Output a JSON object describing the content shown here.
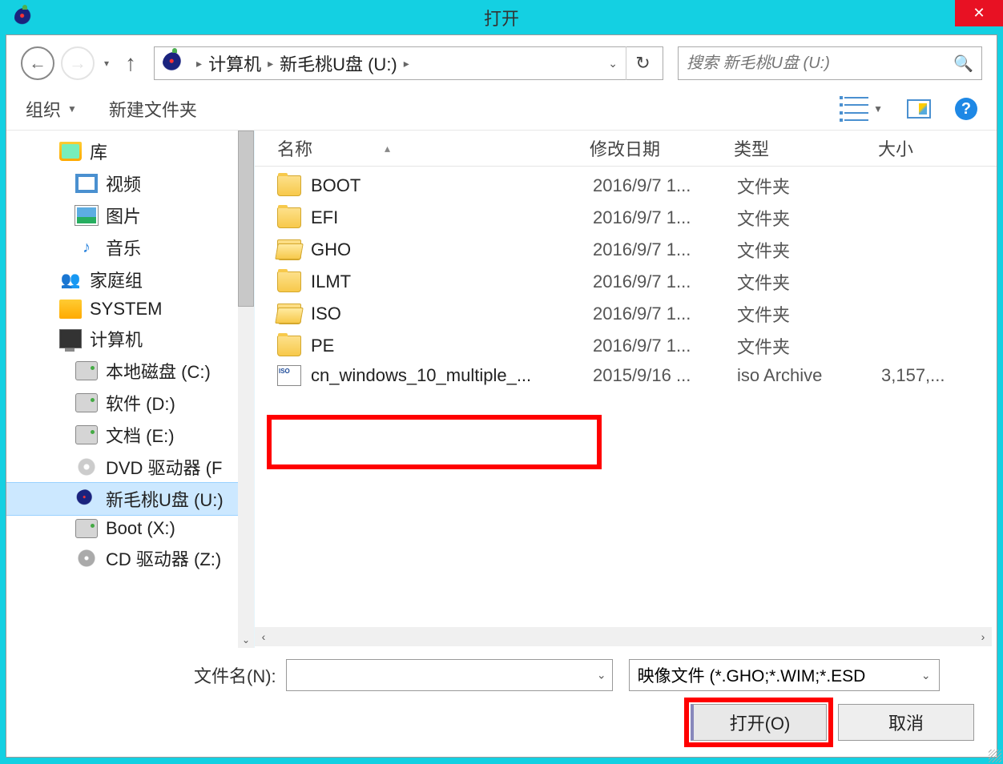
{
  "window": {
    "title": "打开",
    "close": "✕"
  },
  "nav": {
    "breadcrumb": {
      "computer": "计算机",
      "drive": "新毛桃U盘 (U:)"
    },
    "search_placeholder": "搜索 新毛桃U盘 (U:)"
  },
  "toolbar": {
    "organize": "组织",
    "new_folder": "新建文件夹"
  },
  "tree": {
    "libraries": "库",
    "videos": "视频",
    "pictures": "图片",
    "music": "音乐",
    "homegroup": "家庭组",
    "system": "SYSTEM",
    "computer": "计算机",
    "local_c": "本地磁盘 (C:)",
    "soft_d": "软件 (D:)",
    "doc_e": "文档 (E:)",
    "dvd_f": "DVD 驱动器 (F",
    "peach_u": "新毛桃U盘 (U:)",
    "boot_x": "Boot (X:)",
    "cd_z": "CD 驱动器 (Z:)"
  },
  "columns": {
    "name": "名称",
    "date": "修改日期",
    "type": "类型",
    "size": "大小"
  },
  "files": [
    {
      "name": "BOOT",
      "date": "2016/9/7 1...",
      "type": "文件夹",
      "size": "",
      "icon": "folder"
    },
    {
      "name": "EFI",
      "date": "2016/9/7 1...",
      "type": "文件夹",
      "size": "",
      "icon": "folder"
    },
    {
      "name": "GHO",
      "date": "2016/9/7 1...",
      "type": "文件夹",
      "size": "",
      "icon": "folder-open"
    },
    {
      "name": "ILMT",
      "date": "2016/9/7 1...",
      "type": "文件夹",
      "size": "",
      "icon": "folder"
    },
    {
      "name": "ISO",
      "date": "2016/9/7 1...",
      "type": "文件夹",
      "size": "",
      "icon": "folder-open"
    },
    {
      "name": "PE",
      "date": "2016/9/7 1...",
      "type": "文件夹",
      "size": "",
      "icon": "folder"
    },
    {
      "name": "cn_windows_10_multiple_...",
      "date": "2015/9/16 ...",
      "type": "iso Archive",
      "size": "3,157,...",
      "icon": "iso"
    }
  ],
  "bottom": {
    "filename_label": "文件名(N):",
    "filename_value": "",
    "filter": "映像文件 (*.GHO;*.WIM;*.ESD",
    "open": "打开(O)",
    "cancel": "取消"
  }
}
